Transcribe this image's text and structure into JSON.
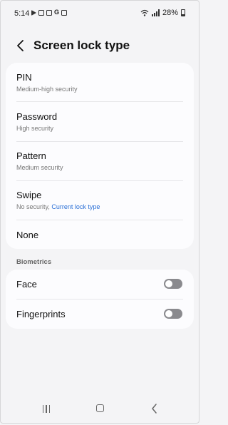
{
  "status_bar": {
    "time": "5:14",
    "battery": "28%",
    "notification_icons": [
      "play-store-icon",
      "check-icon",
      "gallery-icon",
      "google-icon",
      "calendar-icon"
    ]
  },
  "header": {
    "title": "Screen lock type"
  },
  "lock_types": [
    {
      "label": "PIN",
      "sub": "Medium-high security"
    },
    {
      "label": "Password",
      "sub": "High security"
    },
    {
      "label": "Pattern",
      "sub": "Medium security"
    },
    {
      "label": "Swipe",
      "sub": "No security,",
      "current": "Current lock type"
    },
    {
      "label": "None"
    }
  ],
  "biometrics": {
    "header": "Biometrics",
    "items": [
      {
        "label": "Face",
        "enabled": false
      },
      {
        "label": "Fingerprints",
        "enabled": false
      }
    ]
  },
  "colors": {
    "background": "#f4f4f6",
    "card": "#fcfcfe",
    "accent": "#2a6fd6",
    "toggle_off": "#8a8a8e"
  }
}
